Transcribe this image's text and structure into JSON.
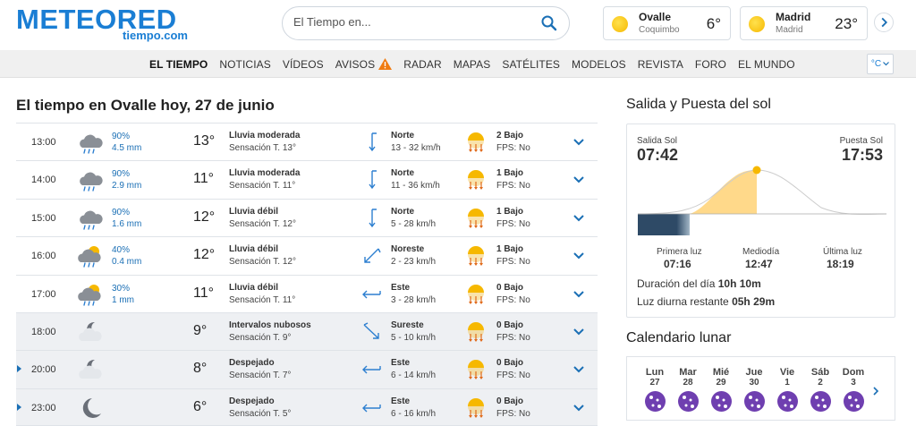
{
  "logo": {
    "main": "METEORED",
    "sub": "tiempo.com"
  },
  "search": {
    "placeholder": "El Tiempo en..."
  },
  "locations": [
    {
      "city": "Ovalle",
      "region": "Coquimbo",
      "temp": "6°"
    },
    {
      "city": "Madrid",
      "region": "Madrid",
      "temp": "23°"
    }
  ],
  "nav": {
    "items": [
      "EL TIEMPO",
      "NOTICIAS",
      "VÍDEOS",
      "AVISOS",
      "RADAR",
      "MAPAS",
      "SATÉLITES",
      "MODELOS",
      "REVISTA",
      "FORO",
      "EL MUNDO"
    ],
    "unit": "°C"
  },
  "page_title": "El tiempo en Ovalle hoy, 27 de junio",
  "hourly": [
    {
      "hour": "13:00",
      "icon": "rain-cloud-icon",
      "prob": "90%",
      "amount": "4.5 mm",
      "temp": "13°",
      "cond": "Lluvia moderada",
      "feel": "Sensación T. 13°",
      "dir_icon": "wind-north-icon",
      "dir": "Norte",
      "wind": "13 - 32 km/h",
      "uv": "2 Bajo",
      "fps": "FPS: No"
    },
    {
      "hour": "14:00",
      "icon": "rain-cloud-icon",
      "prob": "90%",
      "amount": "2.9 mm",
      "temp": "11°",
      "cond": "Lluvia moderada",
      "feel": "Sensación T. 11°",
      "dir_icon": "wind-north-icon",
      "dir": "Norte",
      "wind": "11 - 36 km/h",
      "uv": "1 Bajo",
      "fps": "FPS: No"
    },
    {
      "hour": "15:00",
      "icon": "rain-cloud-icon",
      "prob": "90%",
      "amount": "1.6 mm",
      "temp": "12°",
      "cond": "Lluvia débil",
      "feel": "Sensación T. 12°",
      "dir_icon": "wind-north-icon",
      "dir": "Norte",
      "wind": "5 - 28 km/h",
      "uv": "1 Bajo",
      "fps": "FPS: No"
    },
    {
      "hour": "16:00",
      "icon": "sun-rain-cloud-icon",
      "prob": "40%",
      "amount": "0.4 mm",
      "temp": "12°",
      "cond": "Lluvia débil",
      "feel": "Sensación T. 12°",
      "dir_icon": "wind-northeast-icon",
      "dir": "Noreste",
      "wind": "2 - 23 km/h",
      "uv": "1 Bajo",
      "fps": "FPS: No"
    },
    {
      "hour": "17:00",
      "icon": "sun-rain-cloud-icon",
      "prob": "30%",
      "amount": "1 mm",
      "temp": "11°",
      "cond": "Lluvia débil",
      "feel": "Sensación T. 11°",
      "dir_icon": "wind-east-icon",
      "dir": "Este",
      "wind": "3 - 28 km/h",
      "uv": "0 Bajo",
      "fps": "FPS: No"
    },
    {
      "hour": "18:00",
      "icon": "moon-cloud-icon",
      "prob": "",
      "amount": "",
      "temp": "9°",
      "cond": "Intervalos nubosos",
      "feel": "Sensación T. 9°",
      "dir_icon": "wind-southeast-icon",
      "dir": "Sureste",
      "wind": "5 - 10 km/h",
      "uv": "0 Bajo",
      "fps": "FPS: No"
    },
    {
      "hour": "20:00",
      "icon": "moon-cloud-icon",
      "prob": "",
      "amount": "",
      "temp": "8°",
      "cond": "Despejado",
      "feel": "Sensación T. 7°",
      "dir_icon": "wind-east-icon",
      "dir": "Este",
      "wind": "6 - 14 km/h",
      "uv": "0 Bajo",
      "fps": "FPS: No"
    },
    {
      "hour": "23:00",
      "icon": "moon-icon",
      "prob": "",
      "amount": "",
      "temp": "6°",
      "cond": "Despejado",
      "feel": "Sensación T. 5°",
      "dir_icon": "wind-east-icon",
      "dir": "Este",
      "wind": "6 - 16 km/h",
      "uv": "0 Bajo",
      "fps": "FPS: No"
    }
  ],
  "sun": {
    "title": "Salida y Puesta del sol",
    "sunrise_label": "Salida Sol",
    "sunrise": "07:42",
    "sunset_label": "Puesta Sol",
    "sunset": "17:53",
    "first_light_label": "Primera luz",
    "first_light": "07:16",
    "noon_label": "Mediodía",
    "noon": "12:47",
    "last_light_label": "Última luz",
    "last_light": "18:19",
    "day_length_label": "Duración del día",
    "day_length": "10h 10m",
    "remaining_label": "Luz diurna restante",
    "remaining": "05h 29m"
  },
  "moon": {
    "title": "Calendario lunar",
    "days": [
      {
        "day": "Lun",
        "num": "27"
      },
      {
        "day": "Mar",
        "num": "28"
      },
      {
        "day": "Mié",
        "num": "29"
      },
      {
        "day": "Jue",
        "num": "30"
      },
      {
        "day": "Vie",
        "num": "1"
      },
      {
        "day": "Sáb",
        "num": "2"
      },
      {
        "day": "Dom",
        "num": "3"
      }
    ]
  },
  "colors": {
    "brand": "#1a7ed4",
    "link": "#1a6fb5",
    "moon": "#6f3fb0",
    "sun": "#f6b800"
  }
}
